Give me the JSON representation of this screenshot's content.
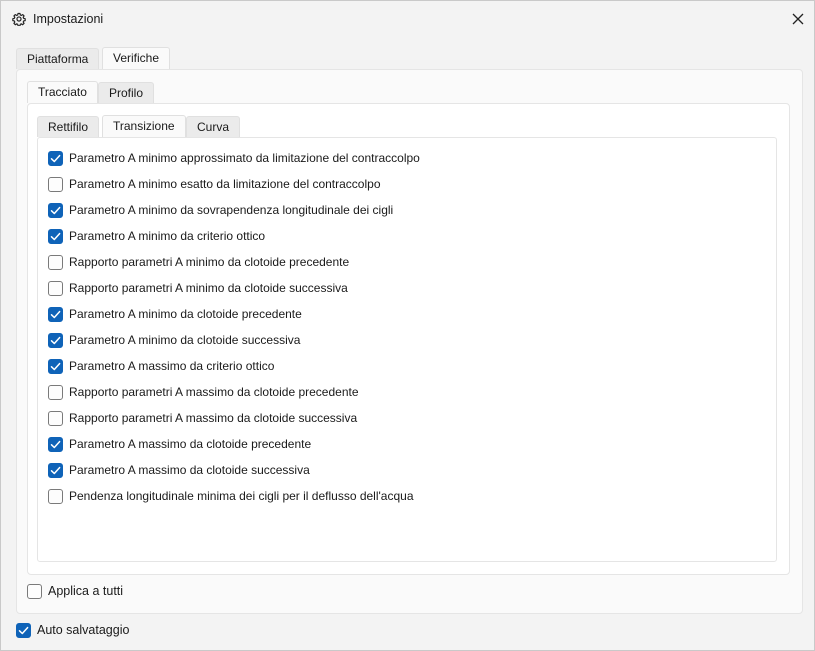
{
  "window": {
    "title": "Impostazioni",
    "icon": "gear-icon",
    "close_icon": "close-icon"
  },
  "tabs_level1": [
    {
      "label": "Piattaforma",
      "active": false
    },
    {
      "label": "Verifiche",
      "active": true
    }
  ],
  "tabs_level2": [
    {
      "label": "Tracciato",
      "active": true
    },
    {
      "label": "Profilo",
      "active": false
    }
  ],
  "tabs_level3": [
    {
      "label": "Rettifilo",
      "active": false
    },
    {
      "label": "Transizione",
      "active": true
    },
    {
      "label": "Curva",
      "active": false
    }
  ],
  "checks": [
    {
      "label": "Parametro A minimo approssimato da limitazione del contraccolpo",
      "checked": true
    },
    {
      "label": "Parametro A minimo esatto da limitazione del contraccolpo",
      "checked": false
    },
    {
      "label": "Parametro A minimo da sovrapendenza longitudinale dei cigli",
      "checked": true
    },
    {
      "label": "Parametro A minimo da criterio ottico",
      "checked": true
    },
    {
      "label": "Rapporto parametri A minimo da clotoide precedente",
      "checked": false
    },
    {
      "label": "Rapporto parametri A minimo da clotoide successiva",
      "checked": false
    },
    {
      "label": "Parametro A minimo da clotoide precedente",
      "checked": true
    },
    {
      "label": "Parametro A minimo da clotoide successiva",
      "checked": true
    },
    {
      "label": "Parametro A massimo da criterio ottico",
      "checked": true
    },
    {
      "label": "Rapporto parametri A massimo da clotoide precedente",
      "checked": false
    },
    {
      "label": "Rapporto parametri A massimo da clotoide successiva",
      "checked": false
    },
    {
      "label": "Parametro A massimo da clotoide precedente",
      "checked": true
    },
    {
      "label": "Parametro A massimo da clotoide successiva",
      "checked": true
    },
    {
      "label": "Pendenza longitudinale minima dei cigli per il deflusso dell'acqua",
      "checked": false
    }
  ],
  "apply_all": {
    "label": "Applica a tutti",
    "checked": false
  },
  "auto_save": {
    "label": "Auto salvataggio",
    "checked": true
  },
  "colors": {
    "accent": "#0f63b8",
    "background": "#f3f3f3"
  }
}
